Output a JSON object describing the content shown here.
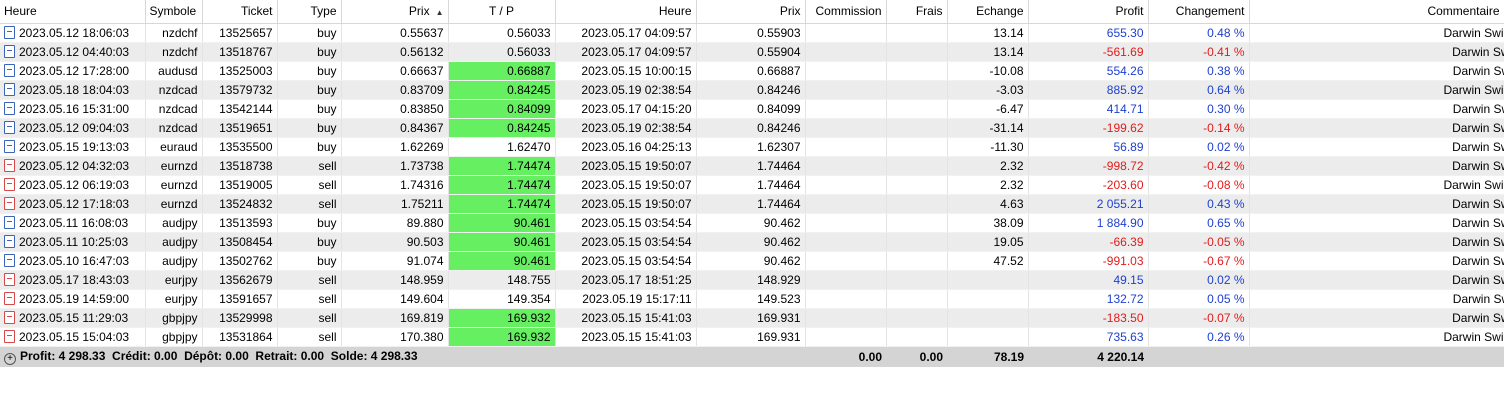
{
  "columns": [
    "Heure",
    "Symbole",
    "Ticket",
    "Type",
    "Prix",
    "T / P",
    "Heure",
    "Prix",
    "Commission",
    "Frais",
    "Echange",
    "Profit",
    "Changement",
    "Commentaire"
  ],
  "rows": [
    {
      "open_time": "2023.05.12 18:06:03",
      "symbol": "nzdchf",
      "ticket": "13525657",
      "type": "buy",
      "price": "0.55637",
      "tp": "0.56033",
      "close_time": "2023.05.17 04:09:57",
      "close_price": "0.55903",
      "commission": "",
      "fees": "",
      "swap": "13.14",
      "profit": "655.30",
      "change": "0.48 %",
      "comment": "Darwin Swing NR",
      "tp_hit": false
    },
    {
      "open_time": "2023.05.12 04:40:03",
      "symbol": "nzdchf",
      "ticket": "13518767",
      "type": "buy",
      "price": "0.56132",
      "tp": "0.56033",
      "close_time": "2023.05.17 04:09:57",
      "close_price": "0.55904",
      "commission": "",
      "fees": "",
      "swap": "13.14",
      "profit": "-561.69",
      "change": "-0.41 %",
      "comment": "Darwin Swing N",
      "tp_hit": false
    },
    {
      "open_time": "2023.05.12 17:28:00",
      "symbol": "audusd",
      "ticket": "13525003",
      "type": "buy",
      "price": "0.66637",
      "tp": "0.66887",
      "close_time": "2023.05.15 10:00:15",
      "close_price": "0.66887",
      "commission": "",
      "fees": "",
      "swap": "-10.08",
      "profit": "554.26",
      "change": "0.38 %",
      "comment": "Darwin Swing E",
      "tp_hit": true
    },
    {
      "open_time": "2023.05.18 18:04:03",
      "symbol": "nzdcad",
      "ticket": "13579732",
      "type": "buy",
      "price": "0.83709",
      "tp": "0.84245",
      "close_time": "2023.05.19 02:38:54",
      "close_price": "0.84246",
      "commission": "",
      "fees": "",
      "swap": "-3.03",
      "profit": "885.92",
      "change": "0.64 %",
      "comment": "Darwin Swing NR",
      "tp_hit": true
    },
    {
      "open_time": "2023.05.16 15:31:00",
      "symbol": "nzdcad",
      "ticket": "13542144",
      "type": "buy",
      "price": "0.83850",
      "tp": "0.84099",
      "close_time": "2023.05.17 04:15:20",
      "close_price": "0.84099",
      "commission": "",
      "fees": "",
      "swap": "-6.47",
      "profit": "414.71",
      "change": "0.30 %",
      "comment": "Darwin Swing E",
      "tp_hit": true
    },
    {
      "open_time": "2023.05.12 09:04:03",
      "symbol": "nzdcad",
      "ticket": "13519651",
      "type": "buy",
      "price": "0.84367",
      "tp": "0.84245",
      "close_time": "2023.05.19 02:38:54",
      "close_price": "0.84246",
      "commission": "",
      "fees": "",
      "swap": "-31.14",
      "profit": "-199.62",
      "change": "-0.14 %",
      "comment": "Darwin Swing N",
      "tp_hit": true
    },
    {
      "open_time": "2023.05.15 19:13:03",
      "symbol": "euraud",
      "ticket": "13535500",
      "type": "buy",
      "price": "1.62269",
      "tp": "1.62470",
      "close_time": "2023.05.16 04:25:13",
      "close_price": "1.62307",
      "commission": "",
      "fees": "",
      "swap": "-11.30",
      "profit": "56.89",
      "change": "0.02 %",
      "comment": "Darwin Swing N",
      "tp_hit": false
    },
    {
      "open_time": "2023.05.12 04:32:03",
      "symbol": "eurnzd",
      "ticket": "13518738",
      "type": "sell",
      "price": "1.73738",
      "tp": "1.74474",
      "close_time": "2023.05.15 19:50:07",
      "close_price": "1.74464",
      "commission": "",
      "fees": "",
      "swap": "2.32",
      "profit": "-998.72",
      "change": "-0.42 %",
      "comment": "Darwin Swing N",
      "tp_hit": true
    },
    {
      "open_time": "2023.05.12 06:19:03",
      "symbol": "eurnzd",
      "ticket": "13519005",
      "type": "sell",
      "price": "1.74316",
      "tp": "1.74474",
      "close_time": "2023.05.15 19:50:07",
      "close_price": "1.74464",
      "commission": "",
      "fees": "",
      "swap": "2.32",
      "profit": "-203.60",
      "change": "-0.08 %",
      "comment": "Darwin Swing NR",
      "tp_hit": true
    },
    {
      "open_time": "2023.05.12 17:18:03",
      "symbol": "eurnzd",
      "ticket": "13524832",
      "type": "sell",
      "price": "1.75211",
      "tp": "1.74474",
      "close_time": "2023.05.15 19:50:07",
      "close_price": "1.74464",
      "commission": "",
      "fees": "",
      "swap": "4.63",
      "profit": "2 055.21",
      "change": "0.43 %",
      "comment": "Darwin Swing N",
      "tp_hit": true
    },
    {
      "open_time": "2023.05.11 16:08:03",
      "symbol": "audjpy",
      "ticket": "13513593",
      "type": "buy",
      "price": "89.880",
      "tp": "90.461",
      "close_time": "2023.05.15 03:54:54",
      "close_price": "90.462",
      "commission": "",
      "fees": "",
      "swap": "38.09",
      "profit": "1 884.90",
      "change": "0.65 %",
      "comment": "Darwin Swing N",
      "tp_hit": true
    },
    {
      "open_time": "2023.05.11 10:25:03",
      "symbol": "audjpy",
      "ticket": "13508454",
      "type": "buy",
      "price": "90.503",
      "tp": "90.461",
      "close_time": "2023.05.15 03:54:54",
      "close_price": "90.462",
      "commission": "",
      "fees": "",
      "swap": "19.05",
      "profit": "-66.39",
      "change": "-0.05 %",
      "comment": "Darwin Swing N",
      "tp_hit": true
    },
    {
      "open_time": "2023.05.10 16:47:03",
      "symbol": "audjpy",
      "ticket": "13502762",
      "type": "buy",
      "price": "91.074",
      "tp": "90.461",
      "close_time": "2023.05.15 03:54:54",
      "close_price": "90.462",
      "commission": "",
      "fees": "",
      "swap": "47.52",
      "profit": "-991.03",
      "change": "-0.67 %",
      "comment": "Darwin Swing N",
      "tp_hit": true
    },
    {
      "open_time": "2023.05.17 18:43:03",
      "symbol": "eurjpy",
      "ticket": "13562679",
      "type": "sell",
      "price": "148.959",
      "tp": "148.755",
      "close_time": "2023.05.17 18:51:25",
      "close_price": "148.929",
      "commission": "",
      "fees": "",
      "swap": "",
      "profit": "49.15",
      "change": "0.02 %",
      "comment": "Darwin Swing N",
      "tp_hit": false
    },
    {
      "open_time": "2023.05.19 14:59:00",
      "symbol": "eurjpy",
      "ticket": "13591657",
      "type": "sell",
      "price": "149.604",
      "tp": "149.354",
      "close_time": "2023.05.19 15:17:11",
      "close_price": "149.523",
      "commission": "",
      "fees": "",
      "swap": "",
      "profit": "132.72",
      "change": "0.05 %",
      "comment": "Darwin Swing E",
      "tp_hit": false
    },
    {
      "open_time": "2023.05.15 11:29:03",
      "symbol": "gbpjpy",
      "ticket": "13529998",
      "type": "sell",
      "price": "169.819",
      "tp": "169.932",
      "close_time": "2023.05.15 15:41:03",
      "close_price": "169.931",
      "commission": "",
      "fees": "",
      "swap": "",
      "profit": "-183.50",
      "change": "-0.07 %",
      "comment": "Darwin Swing N",
      "tp_hit": true
    },
    {
      "open_time": "2023.05.15 15:04:03",
      "symbol": "gbpjpy",
      "ticket": "13531864",
      "type": "sell",
      "price": "170.380",
      "tp": "169.932",
      "close_time": "2023.05.15 15:41:03",
      "close_price": "169.931",
      "commission": "",
      "fees": "",
      "swap": "",
      "profit": "735.63",
      "change": "0.26 %",
      "comment": "Darwin Swing NR",
      "tp_hit": true
    }
  ],
  "summary": {
    "text": "Profit: 4 298.33  Crédit: 0.00  Dépôt: 0.00  Retrait: 0.00  Solde: 4 298.33",
    "commission": "0.00",
    "fees": "0.00",
    "swap": "78.19",
    "profit": "4 220.14"
  },
  "colors": {
    "tp_highlight": "#66ef61",
    "positive": "#1f3fcf",
    "negative": "#e21b1b",
    "alt_row": "#ececec",
    "summary_bg": "#d4d4d4"
  },
  "icons": {
    "buy": "order-buy-icon",
    "sell": "order-sell-icon",
    "sort": "sort-asc-icon",
    "expand": "expand-plus-icon"
  }
}
